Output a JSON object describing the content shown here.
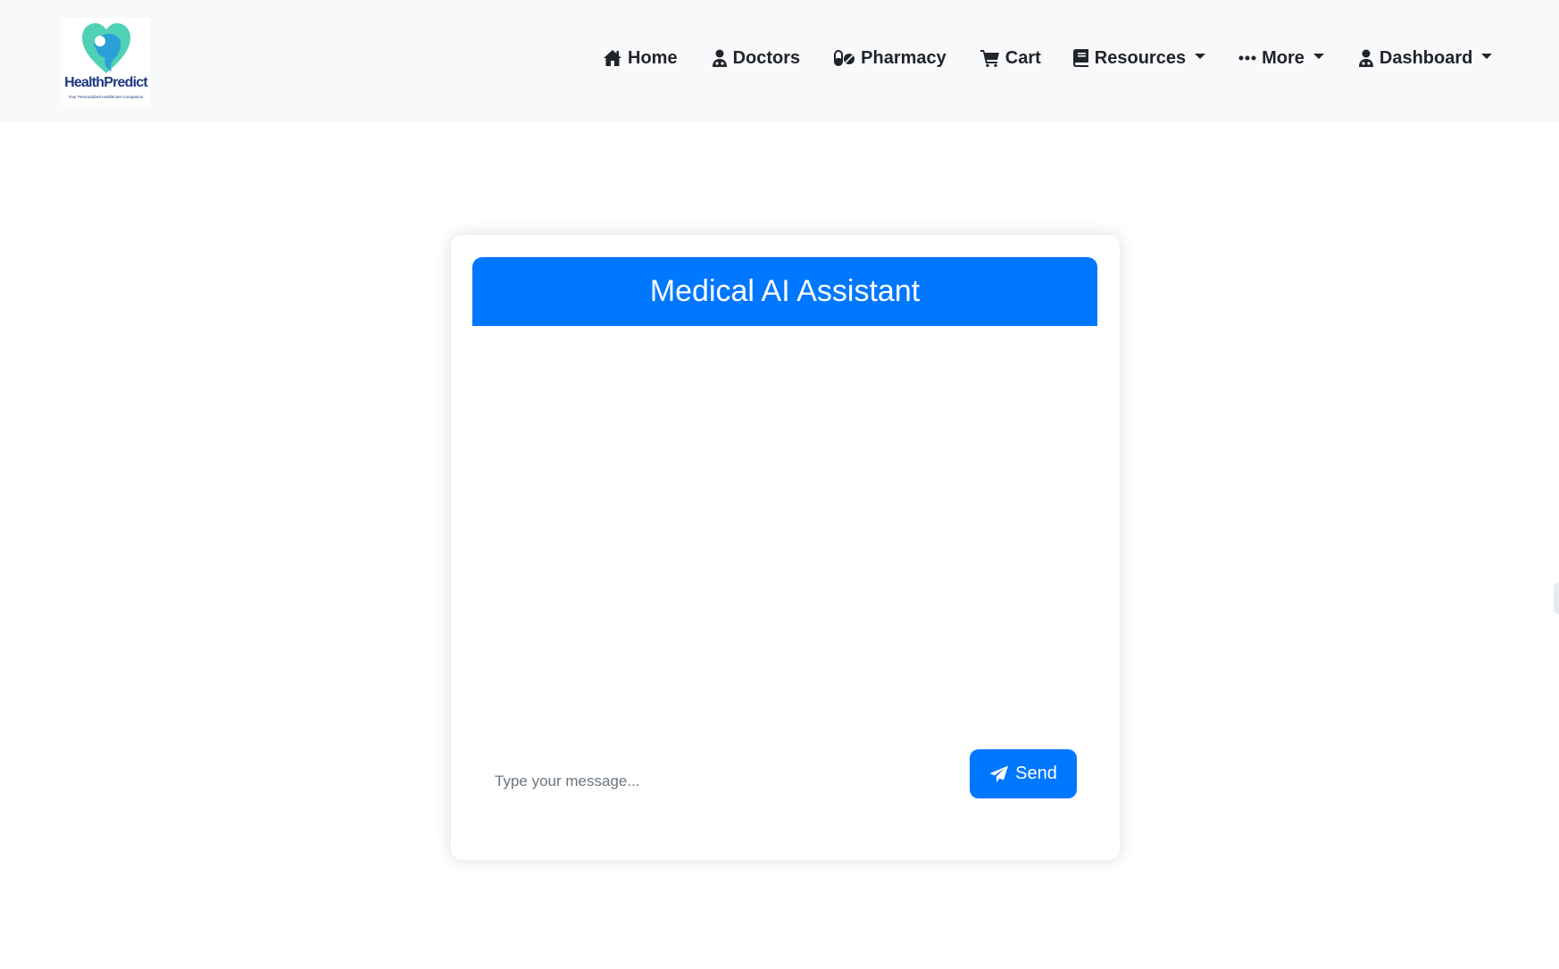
{
  "brand": {
    "name": "HealthPredict",
    "tagline": "Your Personalized Healthcare Companion"
  },
  "nav": {
    "items": [
      {
        "label": "Home",
        "icon": "home-icon",
        "dropdown": false
      },
      {
        "label": "Doctors",
        "icon": "doctor-icon",
        "dropdown": false
      },
      {
        "label": "Pharmacy",
        "icon": "pills-icon",
        "dropdown": false
      },
      {
        "label": "Cart",
        "icon": "cart-icon",
        "dropdown": false
      },
      {
        "label": "Resources",
        "icon": "book-icon",
        "dropdown": true
      },
      {
        "label": "More",
        "icon": "ellipsis-icon",
        "dropdown": true
      },
      {
        "label": "Dashboard",
        "icon": "doctor-icon",
        "dropdown": true
      }
    ]
  },
  "chat": {
    "title": "Medical AI Assistant",
    "input_value": "",
    "input_placeholder": "Type your message...",
    "send_label": "Send"
  },
  "colors": {
    "accent": "#0077ff",
    "navbar_bg": "#f8f9fa",
    "logo_teal": "#4fd1b5",
    "logo_blue": "#2a9fd8",
    "logo_text": "#1f3a82"
  }
}
